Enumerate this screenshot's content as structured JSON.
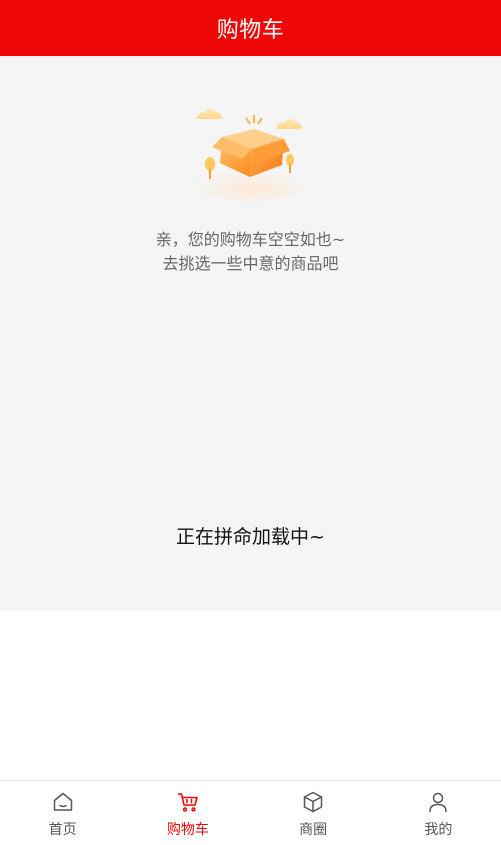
{
  "header": {
    "title": "购物车"
  },
  "cart": {
    "empty_line_1": "亲，您的购物车空空如也~",
    "empty_line_2": "去挑选一些中意的商品吧",
    "loading_text": "正在拼命加载中~"
  },
  "tabbar": {
    "items": [
      {
        "label": "首页",
        "icon": "home-icon",
        "active": false
      },
      {
        "label": "购物车",
        "icon": "cart-icon",
        "active": true
      },
      {
        "label": "商圈",
        "icon": "box-icon",
        "active": false
      },
      {
        "label": "我的",
        "icon": "user-icon",
        "active": false
      }
    ],
    "active_color": "#ef0707",
    "inactive_color": "#555555"
  },
  "theme": {
    "brand_red": "#ef0707",
    "content_bg": "#f5f5f5"
  }
}
